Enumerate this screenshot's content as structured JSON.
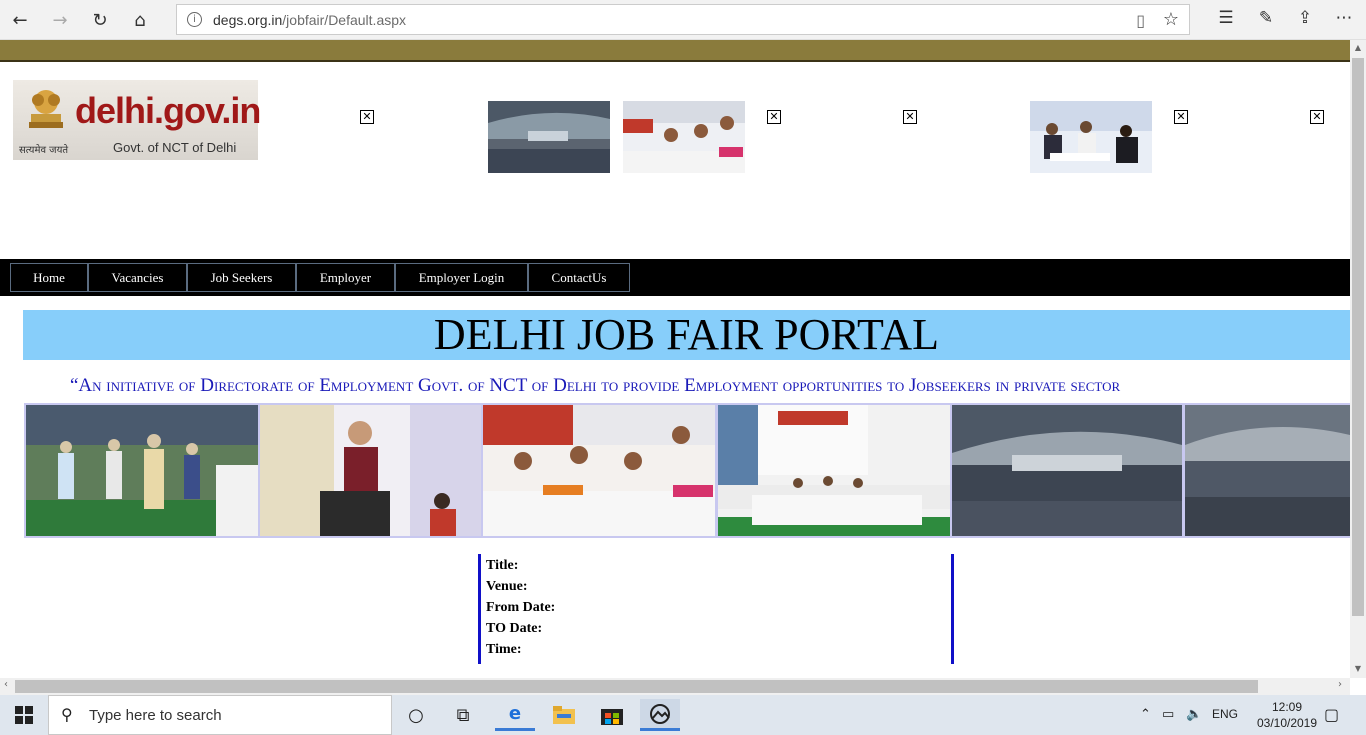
{
  "browser": {
    "url_host": "degs.org.in",
    "url_path": "/jobfair/Default.aspx",
    "back_icon": "←",
    "forward_icon": "→",
    "refresh_icon": "↻",
    "home_icon": "⌂"
  },
  "logo": {
    "brand": "delhi.gov.in",
    "motto": "सत्यमेव जयते",
    "subtitle": "Govt. of NCT of Delhi"
  },
  "menu": {
    "items": [
      "Home",
      "Vacancies",
      "Job Seekers",
      "Employer",
      "Employer Login",
      "ContactUs"
    ]
  },
  "banner": {
    "title": "DELHI JOB FAIR PORTAL",
    "initiative": "“An initiative of Directorate of Employment Govt. of NCT of Delhi to provide Employment opportunities to Jobseekers in private sector"
  },
  "event": {
    "title_label": "Title:",
    "venue_label": "Venue:",
    "from_label": "From Date:",
    "to_label": "TO Date:",
    "time_label": "Time:"
  },
  "taskbar": {
    "search_placeholder": "Type here to search",
    "language": "ENG",
    "time": "12:09",
    "date": "03/10/2019"
  }
}
